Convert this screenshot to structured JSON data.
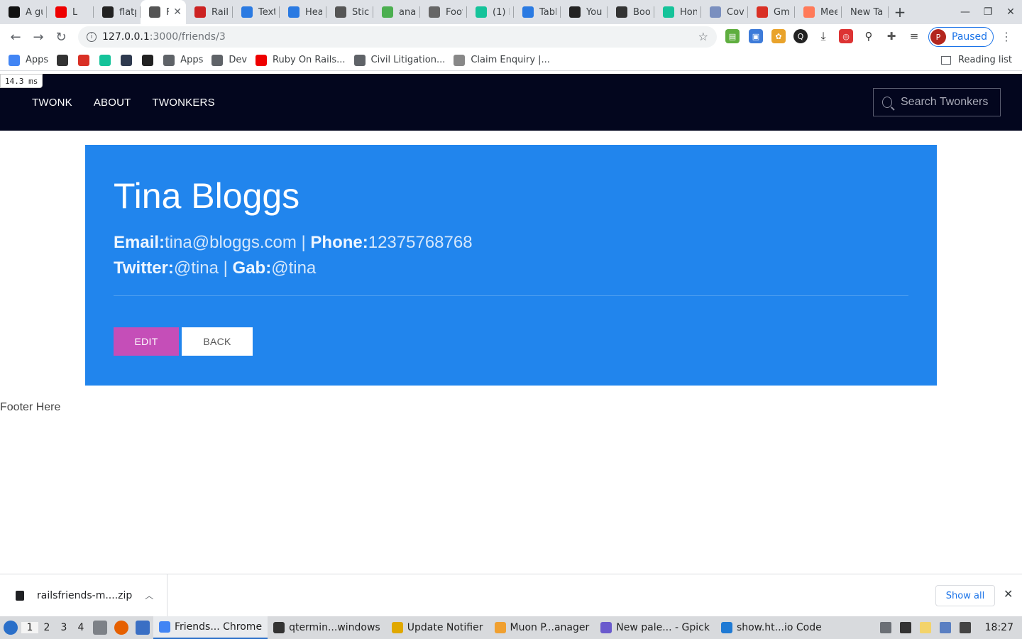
{
  "browser": {
    "tabs": [
      {
        "title": "A gu",
        "icon": "dev-icon",
        "color": "#111"
      },
      {
        "title": "L",
        "icon": "youtube-icon",
        "color": "#e00"
      },
      {
        "title": "flatp",
        "icon": "github-icon",
        "color": "#222"
      },
      {
        "title": "F",
        "icon": "globe-icon",
        "color": "#555",
        "active": true
      },
      {
        "title": "Rail",
        "icon": "rails-icon",
        "color": "#c22"
      },
      {
        "title": "Text",
        "icon": "loader-icon",
        "color": "#2a7ae2"
      },
      {
        "title": "Hea",
        "icon": "loader-icon",
        "color": "#2a7ae2"
      },
      {
        "title": "Stic",
        "icon": "globe-icon",
        "color": "#555"
      },
      {
        "title": "ana",
        "icon": "chrome-icon",
        "color": "#4caf50"
      },
      {
        "title": "Foot",
        "icon": "foot-icon",
        "color": "#666"
      },
      {
        "title": "(1) I",
        "icon": "grammarly-icon",
        "color": "#15c39a"
      },
      {
        "title": "Tabl",
        "icon": "loader-icon",
        "color": "#2a7ae2"
      },
      {
        "title": "You",
        "icon": "github-icon",
        "color": "#222"
      },
      {
        "title": "Boo",
        "icon": "boot-icon",
        "color": "#333"
      },
      {
        "title": "Hon",
        "icon": "grammarly-icon",
        "color": "#15c39a"
      },
      {
        "title": "Cov",
        "icon": "globe-icon",
        "color": "#7a8fbf"
      },
      {
        "title": "Gm",
        "icon": "gmail-icon",
        "color": "#d93025"
      },
      {
        "title": "Mee",
        "icon": "hubspot-icon",
        "color": "#ff7a59"
      },
      {
        "title": "New Ta",
        "icon": "",
        "color": ""
      }
    ],
    "url_host": "127.0.0.1",
    "url_path": ":3000/friends/3",
    "profile_initial": "P",
    "profile_status": "Paused",
    "bookmarks": [
      {
        "label": "Apps",
        "icon": "apps-grid-icon",
        "color": "#4285f4"
      },
      {
        "label": "",
        "icon": "play-store-icon",
        "color": "#333"
      },
      {
        "label": "",
        "icon": "gmail-icon",
        "color": "#d93025"
      },
      {
        "label": "",
        "icon": "grammarly-icon",
        "color": "#15c39a"
      },
      {
        "label": "",
        "icon": "account-icon",
        "color": "#2f3a4f"
      },
      {
        "label": "",
        "icon": "github-icon",
        "color": "#222"
      },
      {
        "label": "Apps",
        "icon": "folder-icon",
        "color": "#5f6368"
      },
      {
        "label": "Dev",
        "icon": "folder-icon",
        "color": "#5f6368"
      },
      {
        "label": "Ruby On Rails...",
        "icon": "youtube-icon",
        "color": "#e00"
      },
      {
        "label": "Civil Litigation...",
        "icon": "globe-icon",
        "color": "#5f6368"
      },
      {
        "label": "Claim Enquiry |...",
        "icon": "claim-icon",
        "color": "#888"
      }
    ],
    "reading_list": "Reading list"
  },
  "timing_badge": "14.3 ms",
  "site_nav": {
    "links": [
      "TWONK",
      "ABOUT",
      "TWONKERS"
    ],
    "search_placeholder": "Search Twonkers"
  },
  "friend": {
    "name": "Tina Bloggs",
    "email_label": "Email:",
    "email": "tina@bloggs.com",
    "phone_label": "Phone:",
    "phone": "12375768768",
    "twitter_label": "Twitter:",
    "twitter": "@tina",
    "gab_label": "Gab:",
    "gab": "@tina",
    "separator": " | "
  },
  "actions": {
    "edit": "EDIT",
    "back": "BACK"
  },
  "footer": "Footer Here",
  "downloads": {
    "filename": "railsfriends-m....zip",
    "show_all": "Show all"
  },
  "taskbar": {
    "desktops": [
      "1",
      "2",
      "3",
      "4"
    ],
    "tasks": [
      {
        "label": "Friends... Chrome",
        "color": "#4285f4",
        "active": true
      },
      {
        "label": "qtermin...windows",
        "color": "#333"
      },
      {
        "label": "Update Notifier",
        "color": "#e0a800"
      },
      {
        "label": "Muon P...anager",
        "color": "#f0a030"
      },
      {
        "label": "New pale... - Gpick",
        "color": "#6a5acd"
      },
      {
        "label": "show.ht...io Code",
        "color": "#1f7ad4"
      }
    ],
    "clock": "18:27"
  }
}
